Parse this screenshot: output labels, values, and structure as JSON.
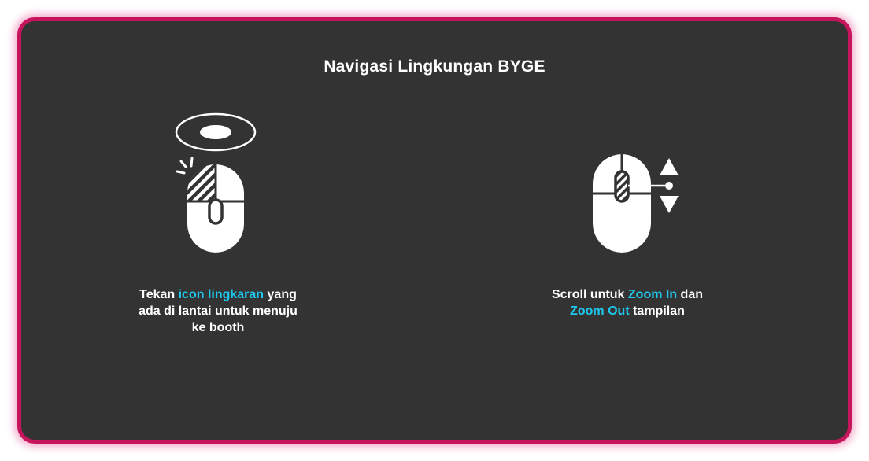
{
  "panel": {
    "title": "Navigasi Lingkungan BYGE"
  },
  "instructions": [
    {
      "icon": "mouse-left-click-icon",
      "text_before": "Tekan ",
      "highlight": "icon lingkaran",
      "text_after_line1": " yang",
      "line2": "ada di lantai untuk menuju",
      "line3": "ke booth"
    },
    {
      "icon": "mouse-scroll-zoom-icon",
      "text_before": "Scroll untuk ",
      "highlight": "Zoom In",
      "text_after_line1": " dan",
      "highlight2": "Zoom Out",
      "line2_after": " tampilan"
    }
  ],
  "colors": {
    "panel_background": "#333333",
    "border": "#c7155d",
    "highlight": "#1ec8ec",
    "text": "#ffffff"
  }
}
